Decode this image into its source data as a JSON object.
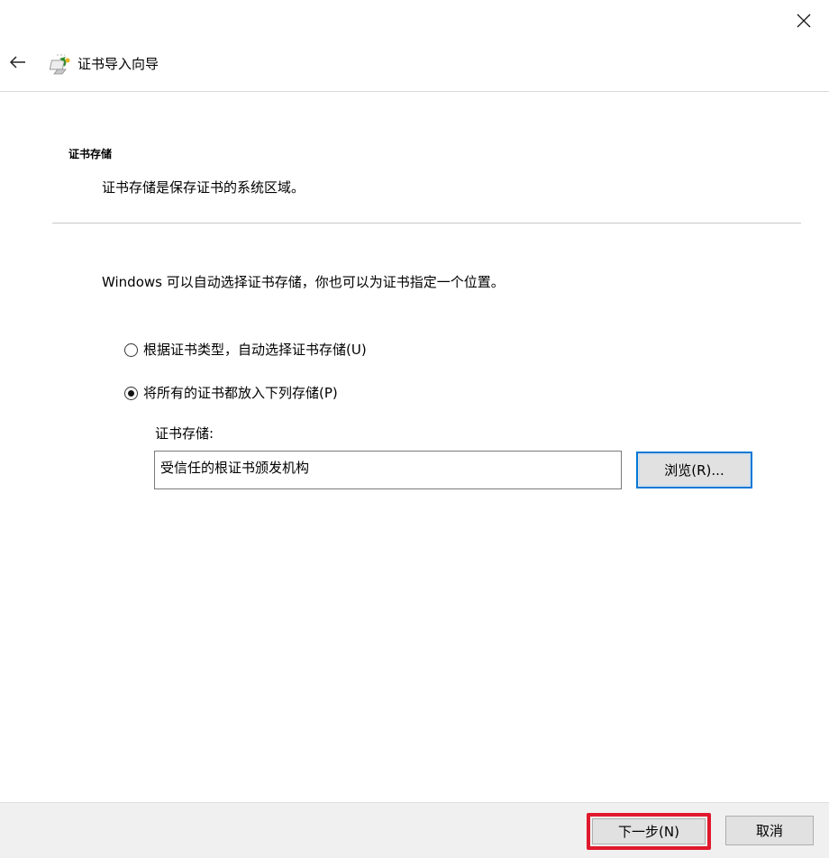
{
  "window": {
    "title": "证书导入向导",
    "close_icon": "close-icon",
    "back_icon": "back-arrow-icon",
    "wizard_icon": "certificate-wizard-icon"
  },
  "header": {
    "title": "证书存储",
    "description": "证书存储是保存证书的系统区域。"
  },
  "body": {
    "intro": "Windows 可以自动选择证书存储，你也可以为证书指定一个位置。",
    "options": [
      {
        "label": "根据证书类型，自动选择证书存储(U)",
        "selected": false
      },
      {
        "label": "将所有的证书都放入下列存储(P)",
        "selected": true
      }
    ],
    "store_label": "证书存储:",
    "store_value": "受信任的根证书颁发机构",
    "browse_label": "浏览(R)..."
  },
  "footer": {
    "next_label": "下一步(N)",
    "cancel_label": "取消"
  },
  "colors": {
    "highlight": "#e0182d",
    "focus_border": "#0078d7"
  }
}
